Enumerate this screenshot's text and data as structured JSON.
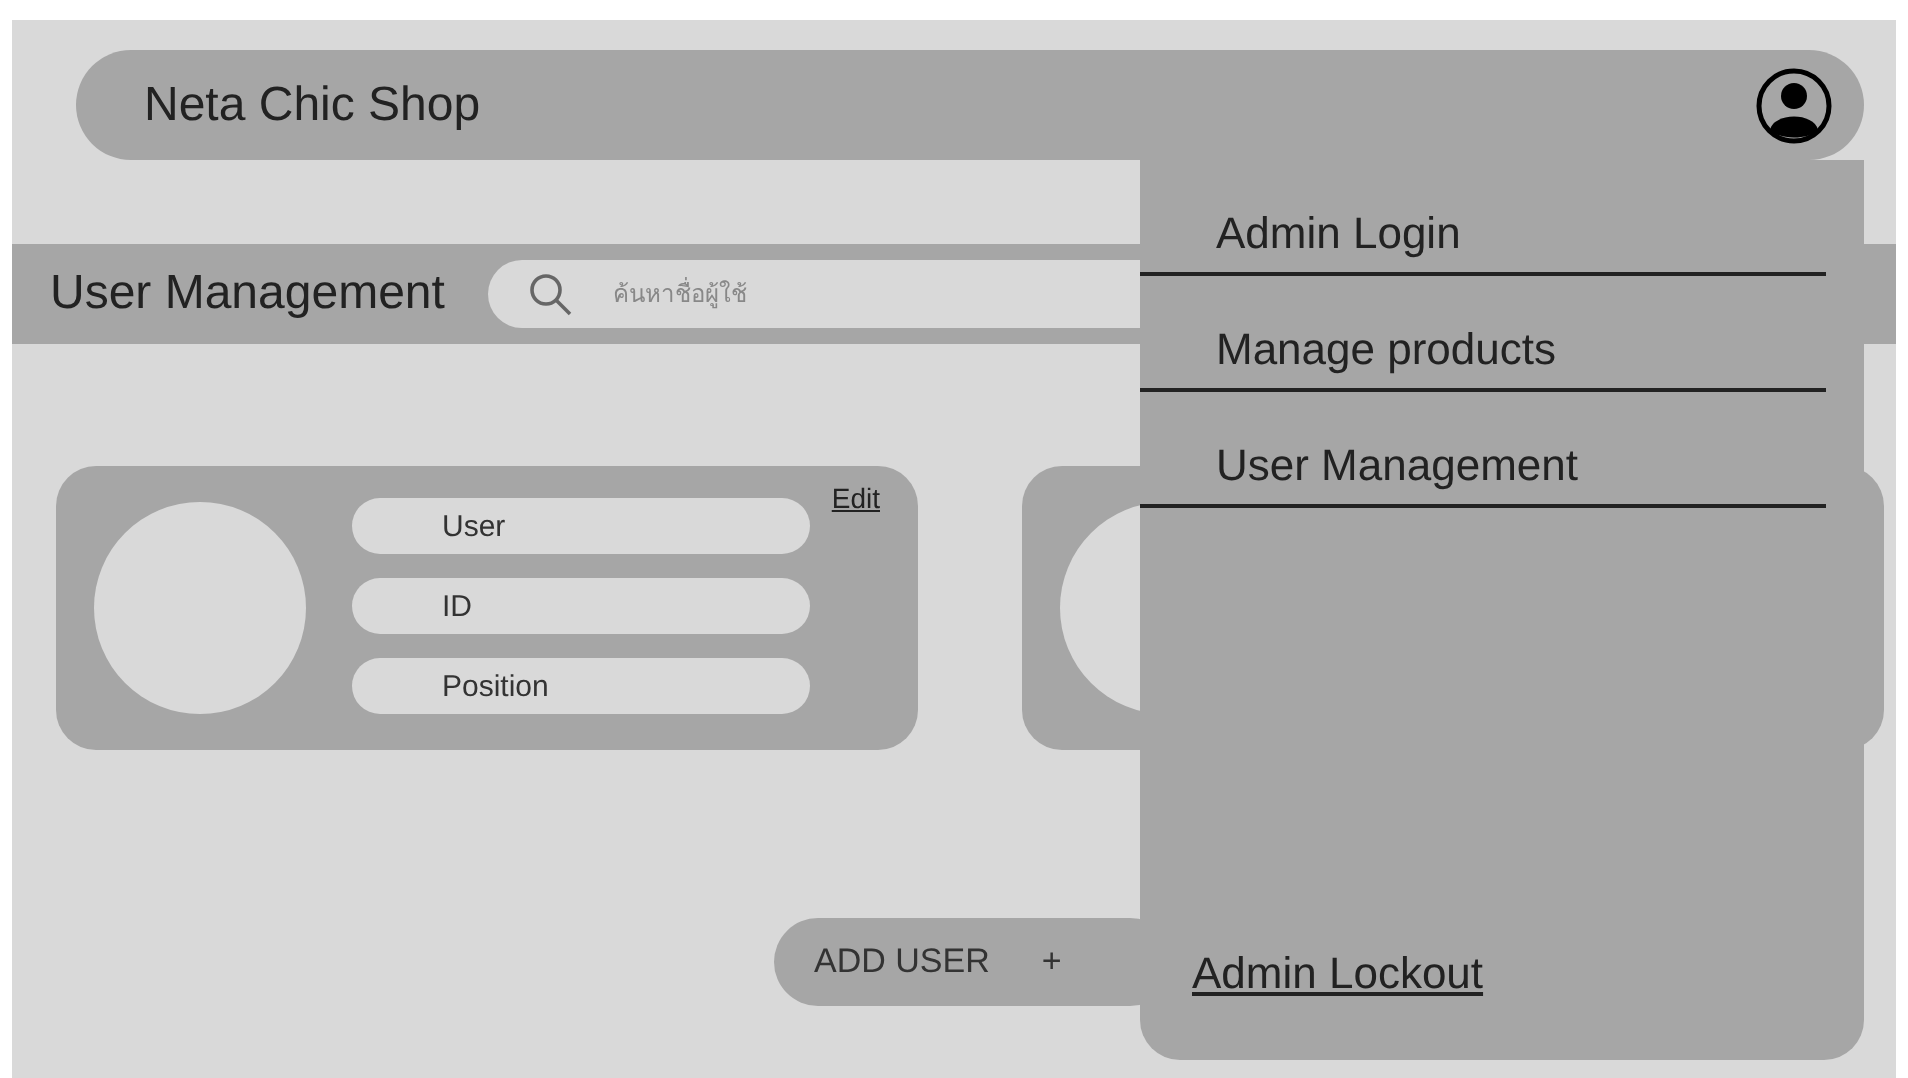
{
  "header": {
    "title": "Neta Chic Shop"
  },
  "toolbar": {
    "title": "User Management",
    "search": {
      "placeholder": "ค้นหาชื่อผู้ใช้"
    }
  },
  "cards": [
    {
      "kind": "user",
      "fields": [
        "User",
        "ID",
        "Position"
      ],
      "edit": "Edit"
    },
    {
      "kind": "covered"
    }
  ],
  "add_button": {
    "label": "ADD USER",
    "icon": "+"
  },
  "menu": {
    "items": [
      "Admin Login",
      "Manage products",
      "User Management"
    ],
    "logout": "Admin Lockout"
  }
}
